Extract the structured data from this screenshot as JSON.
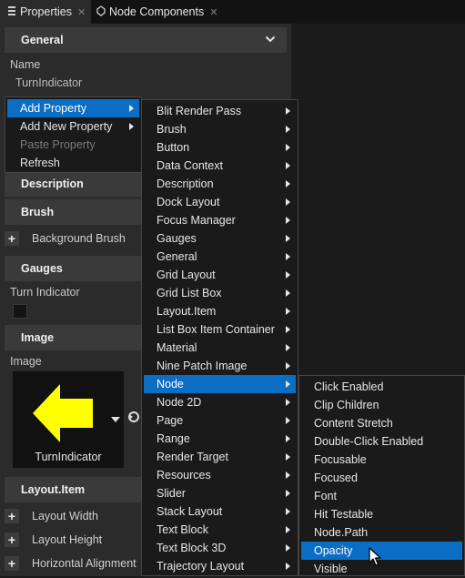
{
  "tabs": [
    {
      "label": "Properties",
      "close": "✕",
      "icon": "properties-tab-icon"
    },
    {
      "label": "Node Components",
      "close": "✕",
      "icon": "node-components-icon"
    }
  ],
  "panel": {
    "sections": {
      "general": "General",
      "description": "Description",
      "brush": "Brush",
      "gauges": "Gauges",
      "image": "Image",
      "layout_item": "Layout.Item"
    },
    "name_label": "Name",
    "name_value": "TurnIndicator",
    "brush_items": [
      "Background Brush"
    ],
    "gauges_label": "Turn Indicator",
    "image_label": "Image",
    "image_name": "TurnIndicator",
    "layout_items": [
      "Layout Width",
      "Layout Height",
      "Horizontal Alignment"
    ],
    "plus": "+"
  },
  "context_menu": [
    {
      "label": "Add Property",
      "submenu": true,
      "state": "highlighted"
    },
    {
      "label": "Add New Property",
      "submenu": true,
      "state": "normal"
    },
    {
      "label": "Paste Property",
      "submenu": false,
      "state": "disabled"
    },
    {
      "label": "Refresh",
      "submenu": false,
      "state": "normal"
    }
  ],
  "component_menu": [
    {
      "label": "Blit Render Pass"
    },
    {
      "label": "Brush"
    },
    {
      "label": "Button"
    },
    {
      "label": "Data Context"
    },
    {
      "label": "Description"
    },
    {
      "label": "Dock Layout"
    },
    {
      "label": "Focus Manager"
    },
    {
      "label": "Gauges"
    },
    {
      "label": "General"
    },
    {
      "label": "Grid Layout"
    },
    {
      "label": "Grid List Box"
    },
    {
      "label": "Layout.Item"
    },
    {
      "label": "List Box Item Container"
    },
    {
      "label": "Material"
    },
    {
      "label": "Nine Patch Image"
    },
    {
      "label": "Node",
      "highlighted": true
    },
    {
      "label": "Node 2D"
    },
    {
      "label": "Page"
    },
    {
      "label": "Range"
    },
    {
      "label": "Render Target"
    },
    {
      "label": "Resources"
    },
    {
      "label": "Slider"
    },
    {
      "label": "Stack Layout"
    },
    {
      "label": "Text Block"
    },
    {
      "label": "Text Block 3D"
    },
    {
      "label": "Trajectory Layout"
    }
  ],
  "node_menu": [
    {
      "label": "Click Enabled"
    },
    {
      "label": "Clip Children"
    },
    {
      "label": "Content Stretch"
    },
    {
      "label": "Double-Click Enabled"
    },
    {
      "label": "Focusable"
    },
    {
      "label": "Focused"
    },
    {
      "label": "Font"
    },
    {
      "label": "Hit Testable"
    },
    {
      "label": "Node.Path"
    },
    {
      "label": "Opacity",
      "highlighted": true
    },
    {
      "label": "Visible"
    }
  ],
  "colors": {
    "highlight": "#0b6dc4",
    "arrow_fill": "#ffff00",
    "panel": "#2b2b2b",
    "menu": "#1a1a1a"
  }
}
